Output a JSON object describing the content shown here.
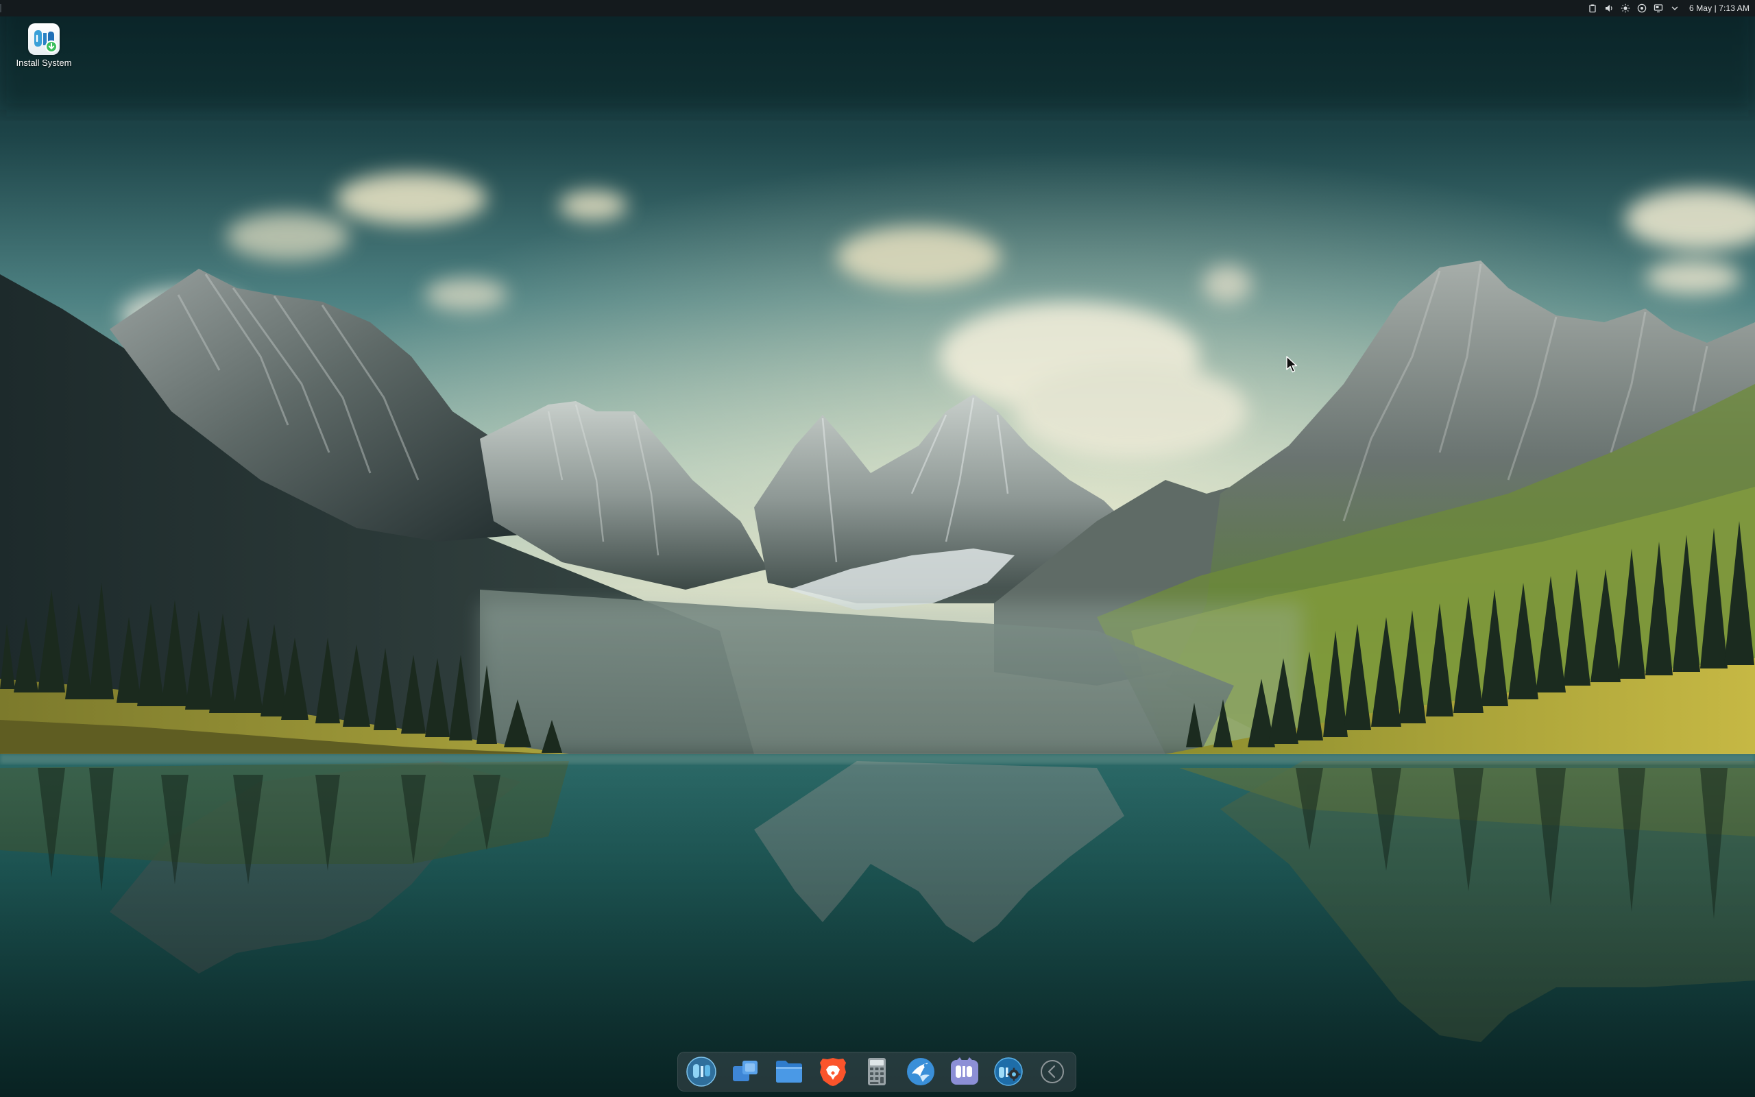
{
  "top_panel": {
    "clock": "6 May | 7:13 AM",
    "tray_icons": [
      "clipboard-icon",
      "volume-icon",
      "brightness-icon",
      "network-icon",
      "display-icon",
      "chevron-down-icon"
    ]
  },
  "desktop": {
    "icons": [
      {
        "label": "Install System",
        "icon": "install-system-icon"
      }
    ]
  },
  "dock": {
    "items": [
      "biglinux-menu-icon",
      "multitasking-icon",
      "file-manager-icon",
      "brave-browser-icon",
      "calculator-icon",
      "software-store-icon",
      "biglinux-welcome-icon",
      "biglinux-settings-icon",
      "back-arrow-icon"
    ]
  },
  "colors": {
    "panel_bg": "#141a1d",
    "panel_text": "#e6e8e9",
    "brave_orange": "#fb542b",
    "folder_blue": "#3d8be0",
    "sky_teal": "#4f8283",
    "lake_teal": "#1f5c5a",
    "meadow_yellow": "#b8b33a"
  }
}
